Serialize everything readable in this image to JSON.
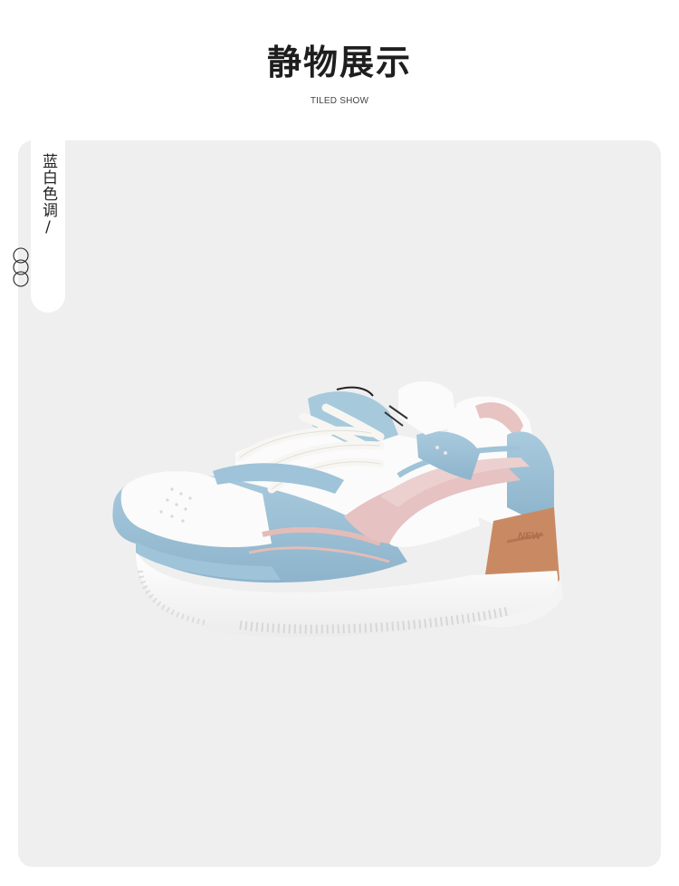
{
  "header": {
    "title": "静物展示",
    "subtitle": "TILED SHOW"
  },
  "color_tag": {
    "label": "蓝白色调/",
    "rings_icon": "three-rings-icon"
  },
  "product_image": {
    "description_icon": "sneaker-illustration",
    "heel_text": "NEW",
    "colors": {
      "blue": "#9fc3d8",
      "pink": "#e6c2c2",
      "tan": "#c98a63",
      "white": "#fbfbfb",
      "lace": "#f6f6f4"
    }
  },
  "theme": {
    "panel_bg": "#efefef",
    "page_bg": "#ffffff",
    "text": "#1e1e1e"
  }
}
